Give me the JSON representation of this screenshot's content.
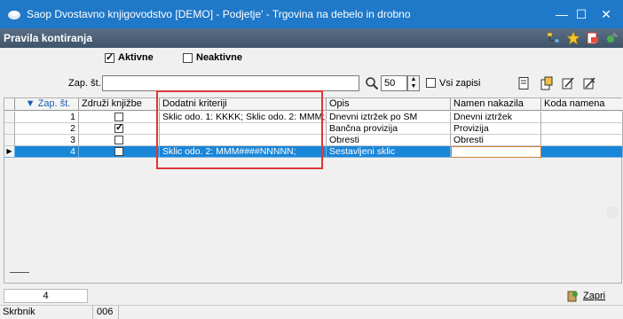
{
  "window": {
    "title": "Saop Dvostavno knjigovodstvo [DEMO] - Podjetje' - Trgovina na debelo in drobno",
    "minimize": "—",
    "maximize": "☐",
    "close": "✕"
  },
  "panel": {
    "title": "Pravila kontiranja",
    "icons": [
      "tree-icon",
      "star-icon",
      "export-icon",
      "tools-icon"
    ]
  },
  "filters": {
    "active_label": "Aktivne",
    "active_checked": true,
    "inactive_label": "Neaktivne",
    "inactive_checked": false
  },
  "search": {
    "label": "Zap. št.",
    "value": "",
    "count": "50",
    "all_records_label": "Vsi zapisi",
    "all_records_checked": false
  },
  "table": {
    "columns": [
      "Zap. št.",
      "Združi knjižbe",
      "Dodatni kriteriji",
      "Opis",
      "Namen nakazila",
      "Koda namena"
    ],
    "sort_indicator": "▼",
    "rows": [
      {
        "num": "1",
        "merge": false,
        "criteria": "Sklic odo. 1: KKKK; Sklic odo. 2: MMM;",
        "desc": "Dnevni iztržek po SM",
        "purpose": "Dnevni iztržek",
        "code": ""
      },
      {
        "num": "2",
        "merge": true,
        "criteria": "",
        "desc": "Bančna provizija",
        "purpose": "Provizija",
        "code": ""
      },
      {
        "num": "3",
        "merge": false,
        "criteria": "",
        "desc": "Obresti",
        "purpose": "Obresti",
        "code": ""
      },
      {
        "num": "4",
        "merge": false,
        "criteria": "Sklic odo. 2: MMM####NNNNN;",
        "desc": "Sestavljeni sklic",
        "purpose": "",
        "code": ""
      }
    ]
  },
  "footer": {
    "record_count": "4",
    "close_label": "Zapri"
  },
  "status": {
    "field_label": "Skrbnik",
    "field_value": "006"
  },
  "colors": {
    "titlebar": "#1f78c8",
    "selection": "#1a86d8",
    "highlight": "#e03535"
  }
}
